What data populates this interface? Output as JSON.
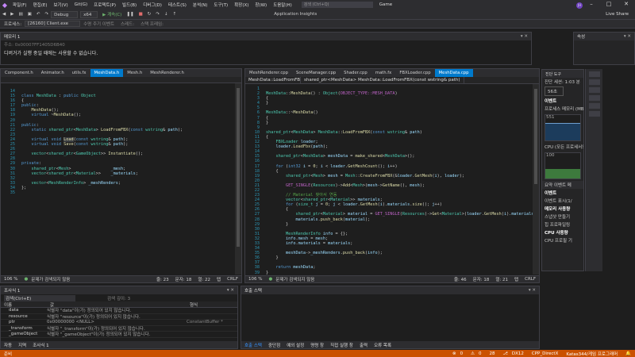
{
  "titlebar": {
    "menu": [
      "파일(F)",
      "편집(E)",
      "보기(V)",
      "Git(G)",
      "프로젝트(P)",
      "빌드(B)",
      "디버그(D)",
      "테스트(S)",
      "분석(N)",
      "도구(T)",
      "확장(X)",
      "창(W)",
      "도움말(H)"
    ],
    "search": "검색 (Ctrl+Q)",
    "project": "Game",
    "user": "JH"
  },
  "toolbar": {
    "config": "Debug",
    "platform": "x64",
    "continue": "계속(C)",
    "app_insights": "Application Insights",
    "live_share": "Live Share"
  },
  "procbar": {
    "label": "프로세스:",
    "process": "[26160] Client.exe",
    "lifecycle": "수명 주기 이벤트",
    "thread": "스레드:",
    "stackframe": "스택 프레임:"
  },
  "watch": {
    "title": "메모리 1",
    "address_label": "주소: 0x00007FF1405D6B40",
    "message": "디버거가 실행 중일 때에는 사용할 수 없습니다."
  },
  "props": {
    "title": "속성"
  },
  "left_editor": {
    "tabs": [
      "Component.h",
      "Animator.h",
      "utils.fx",
      "MeshData.h",
      "Mesh.h",
      "MeshRenderer.h"
    ],
    "active_tab": "MeshData.h",
    "zoom": "106 %",
    "issues": "문제가 검색되지 않음",
    "line": "줄: 23",
    "char": "문자: 18",
    "col": "열: 22",
    "mode": "탭",
    "eol": "CRLF"
  },
  "right_editor": {
    "tabs": [
      "MeshRenderer.cpp",
      "SceneManager.cpp",
      "Shader.cpp",
      "math.fx",
      "FBXLoader.cpp",
      "MeshData.cpp"
    ],
    "active_tab": "MeshData.cpp",
    "nav_class": "MeshData::LoadFromFB",
    "nav_func": "shared_ptr<MeshData> MeshData::LoadFromFBX(const wstring& path)",
    "zoom": "106 %",
    "issues": "문제가 검색되지 않음",
    "line": "줄: 46",
    "char": "문자: 18",
    "col": "열: 21",
    "mode": "탭",
    "eol": "CRLF"
  },
  "diag": {
    "title": "진단 도구",
    "session": "진단 세션: 1:03 분",
    "time_label": "56초",
    "events": "이벤트",
    "memory": "프로세스 메모리 (MB)",
    "mem_max": "551",
    "mem_min": "0",
    "cpu": "CPU (모든 프로세서의 %)",
    "cpu_max": "100",
    "cpu_min": "0",
    "tabs": "요약  이벤트  메",
    "events_sect": "이벤트",
    "events_line": "이벤트 표시(1/",
    "mem_use": "메모리 사용량",
    "snapshot": "스냅샷 만들기",
    "heap": "힙 프로파일링",
    "cpu_use": "CPU 사용량",
    "cpu_rec": "CPU 프로필 기"
  },
  "locals": {
    "title": "조사식 1",
    "search": "검색(Ctrl+E)",
    "depth": "검색 깊이: 3",
    "cols": [
      "이름",
      "값",
      "형식"
    ],
    "rows": [
      {
        "name": "data",
        "value": "식별자 \"data\"이(가) 정의되어 있지 않습니다.",
        "type": ""
      },
      {
        "name": "resource",
        "value": "식별자 \"resource\"이(가) 정의되어 있지 않습니다.",
        "type": ""
      },
      {
        "name": "ptr",
        "value": "0x00000000 <NULL>",
        "type": "ConstantBuffer *"
      },
      {
        "name": "_transform",
        "value": "식별자 \"_transform\"이(가) 정의되어 있지 않습니다.",
        "type": ""
      },
      {
        "name": "_gameObject",
        "value": "식별자 \"_gameObject\"이(가) 정의되어 있지 않습니다.",
        "type": ""
      }
    ],
    "tabs": [
      "자동",
      "지역",
      "조사식 1"
    ]
  },
  "callstack": {
    "title": "호출 스택",
    "tabs": [
      "호출 스택",
      "중단점",
      "예외 설정",
      "명령 창",
      "직접 실행 창",
      "출력",
      "오류 목록"
    ]
  },
  "statusbar": {
    "ready": "준비",
    "errors": "0",
    "warnings": "0",
    "lines": "28",
    "branch": "DX12",
    "repo": "CPP_DirectX",
    "user": "Katas344/게임 프로그래머"
  }
}
